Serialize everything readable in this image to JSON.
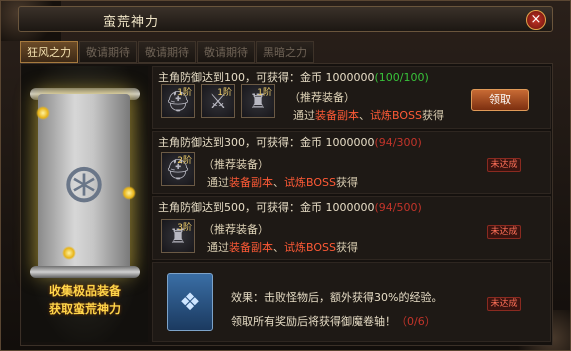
{
  "window": {
    "title": "蛮荒神力",
    "close_glyph": "×"
  },
  "tabs": [
    {
      "label": "狂风之力",
      "active": true
    },
    {
      "label": "敬请期待",
      "active": false
    },
    {
      "label": "敬请期待",
      "active": false
    },
    {
      "label": "敬请期待",
      "active": false
    },
    {
      "label": "黑暗之力",
      "active": false
    }
  ],
  "left_panel": {
    "caption_line1": "收集极品装备",
    "caption_line2": "获取蛮荒神力",
    "emblem_icon": "rune-scroll-icon"
  },
  "rows": [
    {
      "title": "主角防御达到100，可获得：金币 1000000",
      "progress": "(100/100)",
      "items": [
        {
          "level": "1阶",
          "icon": "helmet-icon"
        },
        {
          "level": "1阶",
          "icon": "sword-icon"
        },
        {
          "level": "1阶",
          "icon": "armor-icon"
        }
      ],
      "recommend": "（推荐装备）",
      "via_prefix": "通过",
      "source1": "装备副本",
      "sep": "、",
      "source2": "试炼BOSS",
      "via_suffix": "获得",
      "action": "领取"
    },
    {
      "title": "主角防御达到300，可获得：金币 1000000",
      "progress": "(94/300)",
      "items": [
        {
          "level": "2阶",
          "icon": "helmet-icon"
        }
      ],
      "recommend": "（推荐装备）",
      "via_prefix": "通过",
      "source1": "装备副本",
      "sep": "、",
      "source2": "试炼BOSS",
      "via_suffix": "获得",
      "action": "未达成"
    },
    {
      "title": "主角防御达到500，可获得：金币 1000000",
      "progress": "(94/500)",
      "items": [
        {
          "level": "3阶",
          "icon": "armor-icon"
        }
      ],
      "recommend": "（推荐装备）",
      "via_prefix": "通过",
      "source1": "装备副本",
      "sep": "、",
      "source2": "试炼BOSS",
      "via_suffix": "获得",
      "action": "未达成"
    }
  ],
  "bonus": {
    "effect": "效果：击败怪物后，额外获得30%的经验。",
    "note": "领取所有奖励后将获得御魔卷轴！",
    "progress": "（0/6）",
    "action": "未达成",
    "icon": "scroll-icon"
  },
  "colors": {
    "accent": "#ff5a36",
    "ok": "#38c23a",
    "gold": "#ffd54a"
  }
}
